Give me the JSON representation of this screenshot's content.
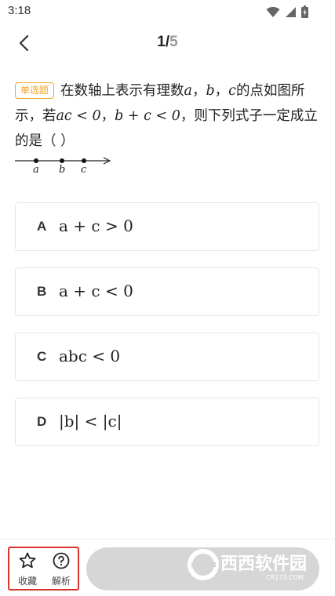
{
  "status": {
    "time": "3:18"
  },
  "header": {
    "current": "1",
    "separator": "/",
    "total": "5"
  },
  "question": {
    "badge": "单选题",
    "seg1": "在数轴上表示有理数",
    "var_a": "a",
    "comma1": "，",
    "var_b": "b",
    "comma2": "，",
    "var_c": "c",
    "seg2": "的点如图所示，若",
    "cond1": "ac < 0",
    "comma3": "，",
    "cond2": "b + c < 0",
    "seg3": "，则下列式子一定成立的是（ ）",
    "numberline_labels": [
      "a",
      "b",
      "c"
    ]
  },
  "options": [
    {
      "letter": "A",
      "expr": "a + c > 0"
    },
    {
      "letter": "B",
      "expr": "a + c < 0"
    },
    {
      "letter": "C",
      "expr": "abc < 0"
    },
    {
      "letter": "D",
      "expr": "|b| < |c|"
    }
  ],
  "bottom": {
    "favorite_label": "收藏",
    "analysis_label": "解析",
    "watermark_brand": "西西软件园",
    "watermark_domain": "CR173.COM"
  },
  "icons": {
    "back": "chevron-left-icon",
    "favorite": "star-icon",
    "analysis": "question-circle-icon",
    "wifi": "wifi-icon",
    "signal": "signal-icon",
    "battery": "battery-icon"
  },
  "colors": {
    "badge": "#f5a623",
    "highlight_border": "#d9342b",
    "submit_button": "#d6d6d6",
    "page_total": "#9a9a9a"
  }
}
